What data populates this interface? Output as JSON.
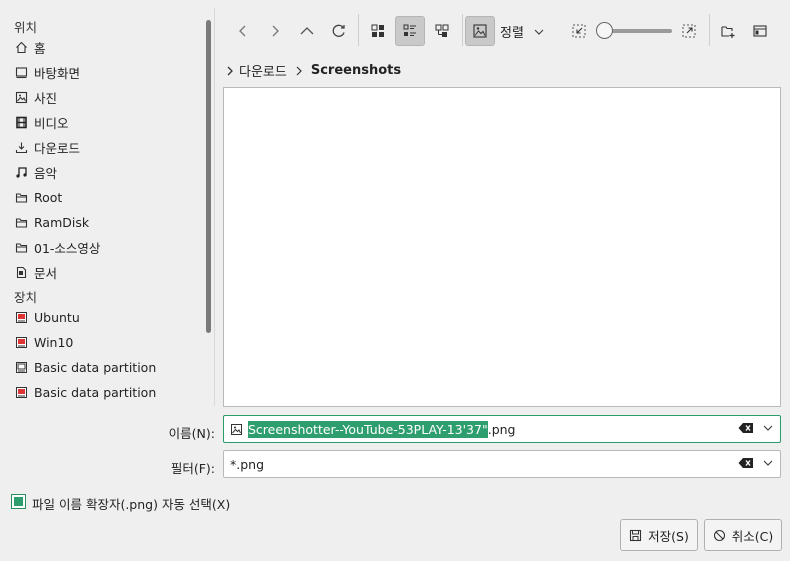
{
  "sidebar": {
    "places_title": "위치",
    "devices_title": "장치",
    "places": [
      {
        "label": "홈",
        "icon": "home-icon"
      },
      {
        "label": "바탕화면",
        "icon": "desktop-icon"
      },
      {
        "label": "사진",
        "icon": "pictures-icon"
      },
      {
        "label": "비디오",
        "icon": "video-icon"
      },
      {
        "label": "다운로드",
        "icon": "download-icon"
      },
      {
        "label": "음악",
        "icon": "music-icon"
      },
      {
        "label": "Root",
        "icon": "folder-icon"
      },
      {
        "label": "RamDisk",
        "icon": "folder-icon"
      },
      {
        "label": "01-소스영상",
        "icon": "folder-icon"
      },
      {
        "label": "문서",
        "icon": "documents-icon"
      }
    ],
    "devices": [
      {
        "label": "Ubuntu",
        "icon": "drive-icon"
      },
      {
        "label": "Win10",
        "icon": "drive-icon"
      },
      {
        "label": "Basic data partition",
        "icon": "partition-icon"
      },
      {
        "label": "Basic data partition",
        "icon": "drive-icon"
      }
    ]
  },
  "toolbar": {
    "sort_label": "정렬"
  },
  "breadcrumb": {
    "parent": "다운로드",
    "current": "Screenshots"
  },
  "form": {
    "name_label": "이름(N):",
    "name_selected": "Screenshotter--YouTube-53PLAY-13'37\"",
    "name_rest": ".png",
    "filter_label": "필터(F):",
    "filter_value": "*.png"
  },
  "options": {
    "auto_ext_label": "파일 이름 확장자(.png) 자동 선택(X)",
    "auto_ext_checked": true
  },
  "buttons": {
    "save": "저장(S)",
    "cancel": "취소(C)"
  },
  "colors": {
    "accent": "#2e9e6e",
    "background": "#efefef"
  }
}
